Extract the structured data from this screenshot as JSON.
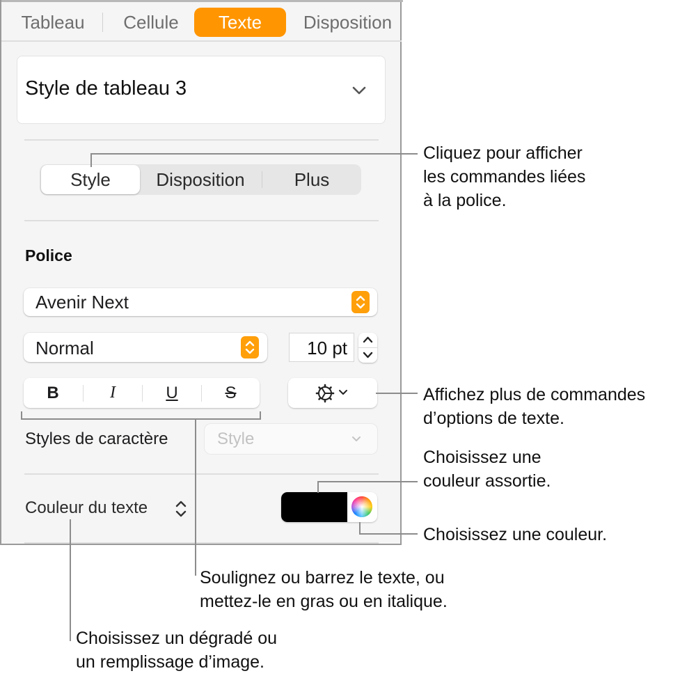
{
  "tabs": [
    {
      "label": "Tableau",
      "active": false
    },
    {
      "label": "Cellule",
      "active": false
    },
    {
      "label": "Texte",
      "active": true
    },
    {
      "label": "Disposition",
      "active": false
    }
  ],
  "table_style": {
    "label": "Style de tableau 3",
    "icon": "chevron-down-icon"
  },
  "segments": [
    {
      "label": "Style",
      "active": true
    },
    {
      "label": "Disposition",
      "active": false
    },
    {
      "label": "Plus",
      "active": false
    }
  ],
  "font_section": {
    "label": "Police",
    "font_family": "Avenir Next",
    "font_typeface": "Normal",
    "font_size": "10 pt",
    "format_buttons": [
      {
        "label": "B",
        "name": "bold"
      },
      {
        "label": "I",
        "name": "italic"
      },
      {
        "label": "U",
        "name": "underline"
      },
      {
        "label": "S",
        "name": "strikethrough"
      }
    ],
    "more_options_icon": "gear-icon"
  },
  "character_styles": {
    "label": "Styles de caractère",
    "placeholder": "Style"
  },
  "text_color": {
    "label": "Couleur du texte",
    "swatch_color": "#000000"
  },
  "colors": {
    "accent": "#ff9500",
    "panel_bg": "#f5f5f5",
    "swatch": "#000000"
  },
  "callouts": [
    {
      "id": "style-tab",
      "text": "Cliquez pour afficher\nles commandes liées\nà la police."
    },
    {
      "id": "more-options",
      "text": "Affichez plus de commandes\nd’options de texte."
    },
    {
      "id": "color-swatch",
      "text": "Choisissez une\ncouleur assortie."
    },
    {
      "id": "color-wheel",
      "text": "Choisissez une couleur."
    },
    {
      "id": "format-buttons",
      "text": "Soulignez ou barrez le texte, ou\nmettez-le en gras ou en italique."
    },
    {
      "id": "text-color-fill",
      "text": "Choisissez un dégradé ou\nun remplissage d’image."
    }
  ]
}
